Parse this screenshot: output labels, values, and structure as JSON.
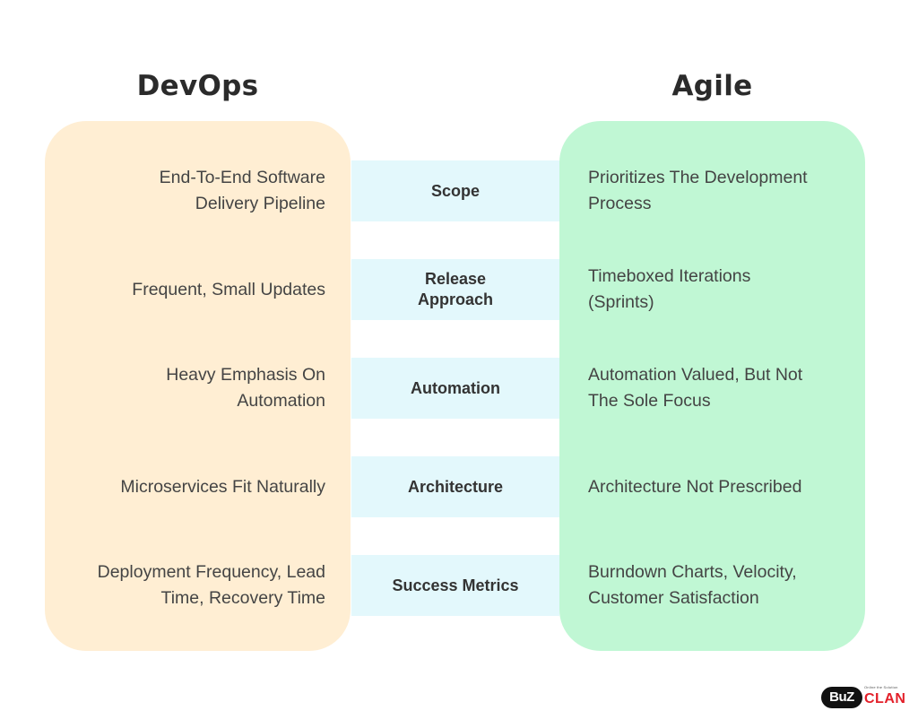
{
  "titles": {
    "left": "DevOps",
    "right": "Agile"
  },
  "rows": [
    {
      "category": "Scope",
      "devops": "End-To-End Software Delivery Pipeline",
      "agile": "Prioritizes The Development Process"
    },
    {
      "category": "Release Approach",
      "devops": "Frequent, Small Updates",
      "agile": "Timeboxed Iterations (Sprints)"
    },
    {
      "category": "Automation",
      "devops": "Heavy Emphasis On Automation",
      "agile": "Automation Valued, But Not The Sole Focus"
    },
    {
      "category": "Architecture",
      "devops": "Microservices Fit Naturally",
      "agile": "Architecture Not Prescribed"
    },
    {
      "category": "Success Metrics",
      "devops": "Deployment Frequency, Lead Time, Recovery Time",
      "agile": "Burndown Charts, Velocity, Customer Satisfaction"
    }
  ],
  "logo": {
    "part1": "BuZ",
    "part2": "CLAN",
    "tagline": "Online the Solution"
  },
  "colors": {
    "devops_panel": "#ffeed3",
    "agile_panel": "#c0f7d4",
    "band": "#e3f8fc",
    "logo_red": "#e3202a"
  }
}
